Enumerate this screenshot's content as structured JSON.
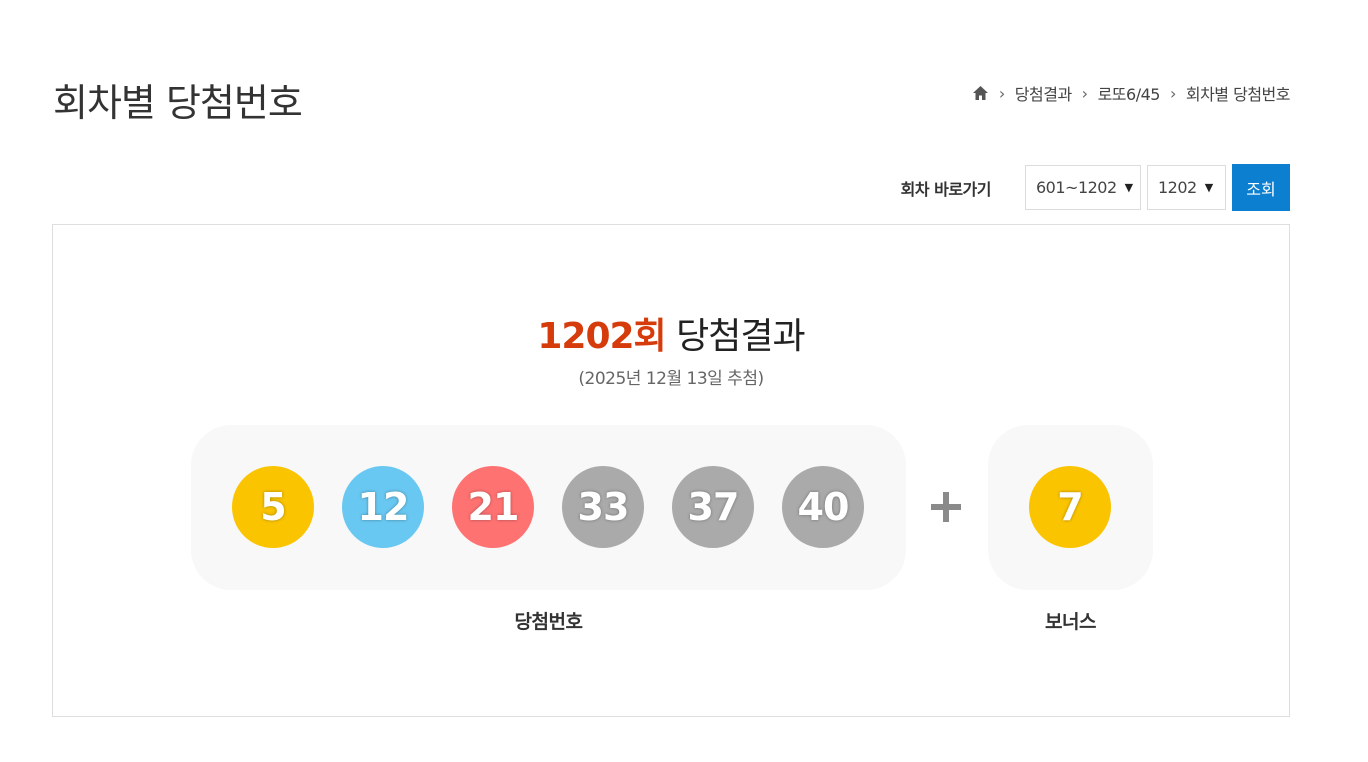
{
  "page": {
    "title": "회차별 당첨번호"
  },
  "breadcrumb": {
    "home_icon": "home-icon",
    "items": [
      "당첨결과",
      "로또6/45",
      "회차별 당첨번호"
    ]
  },
  "toolbar": {
    "label": "회차 바로가기",
    "range_select": "601~1202",
    "round_select": "1202",
    "search_button": "조회",
    "accent_color": "#0c7fd0"
  },
  "result": {
    "round": "1202회",
    "title_suffix": "당첨결과",
    "date": "(2025년 12월 13일 추첨)",
    "numbers": [
      {
        "value": "5",
        "color": "#fbc400"
      },
      {
        "value": "12",
        "color": "#69c8f2"
      },
      {
        "value": "21",
        "color": "#ff7272"
      },
      {
        "value": "33",
        "color": "#aaaaaa"
      },
      {
        "value": "37",
        "color": "#aaaaaa"
      },
      {
        "value": "40",
        "color": "#aaaaaa"
      }
    ],
    "bonus": {
      "value": "7",
      "color": "#fbc400"
    },
    "numbers_caption": "당첨번호",
    "bonus_caption": "보너스",
    "round_color": "#d63b0b"
  }
}
